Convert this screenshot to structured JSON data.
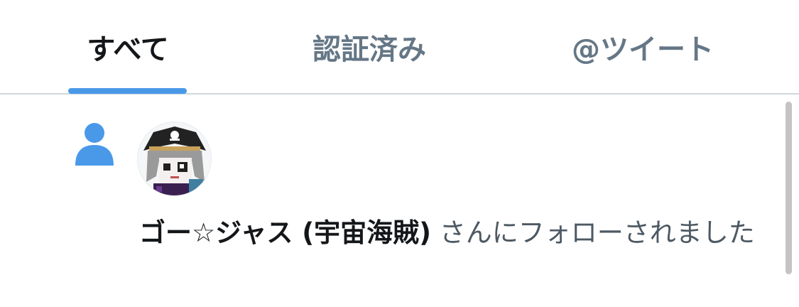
{
  "tabs": [
    {
      "label": "すべて",
      "active": true
    },
    {
      "label": "認証済み",
      "active": false
    },
    {
      "label": "@ツイート",
      "active": false
    }
  ],
  "notification": {
    "icon": "person-icon",
    "user_name": "ゴー☆ジャス (宇宙海賊)",
    "action_text": " さんにフォローされました"
  },
  "colors": {
    "accent": "#4a99e9",
    "text": "#14171a",
    "muted": "#657786"
  }
}
